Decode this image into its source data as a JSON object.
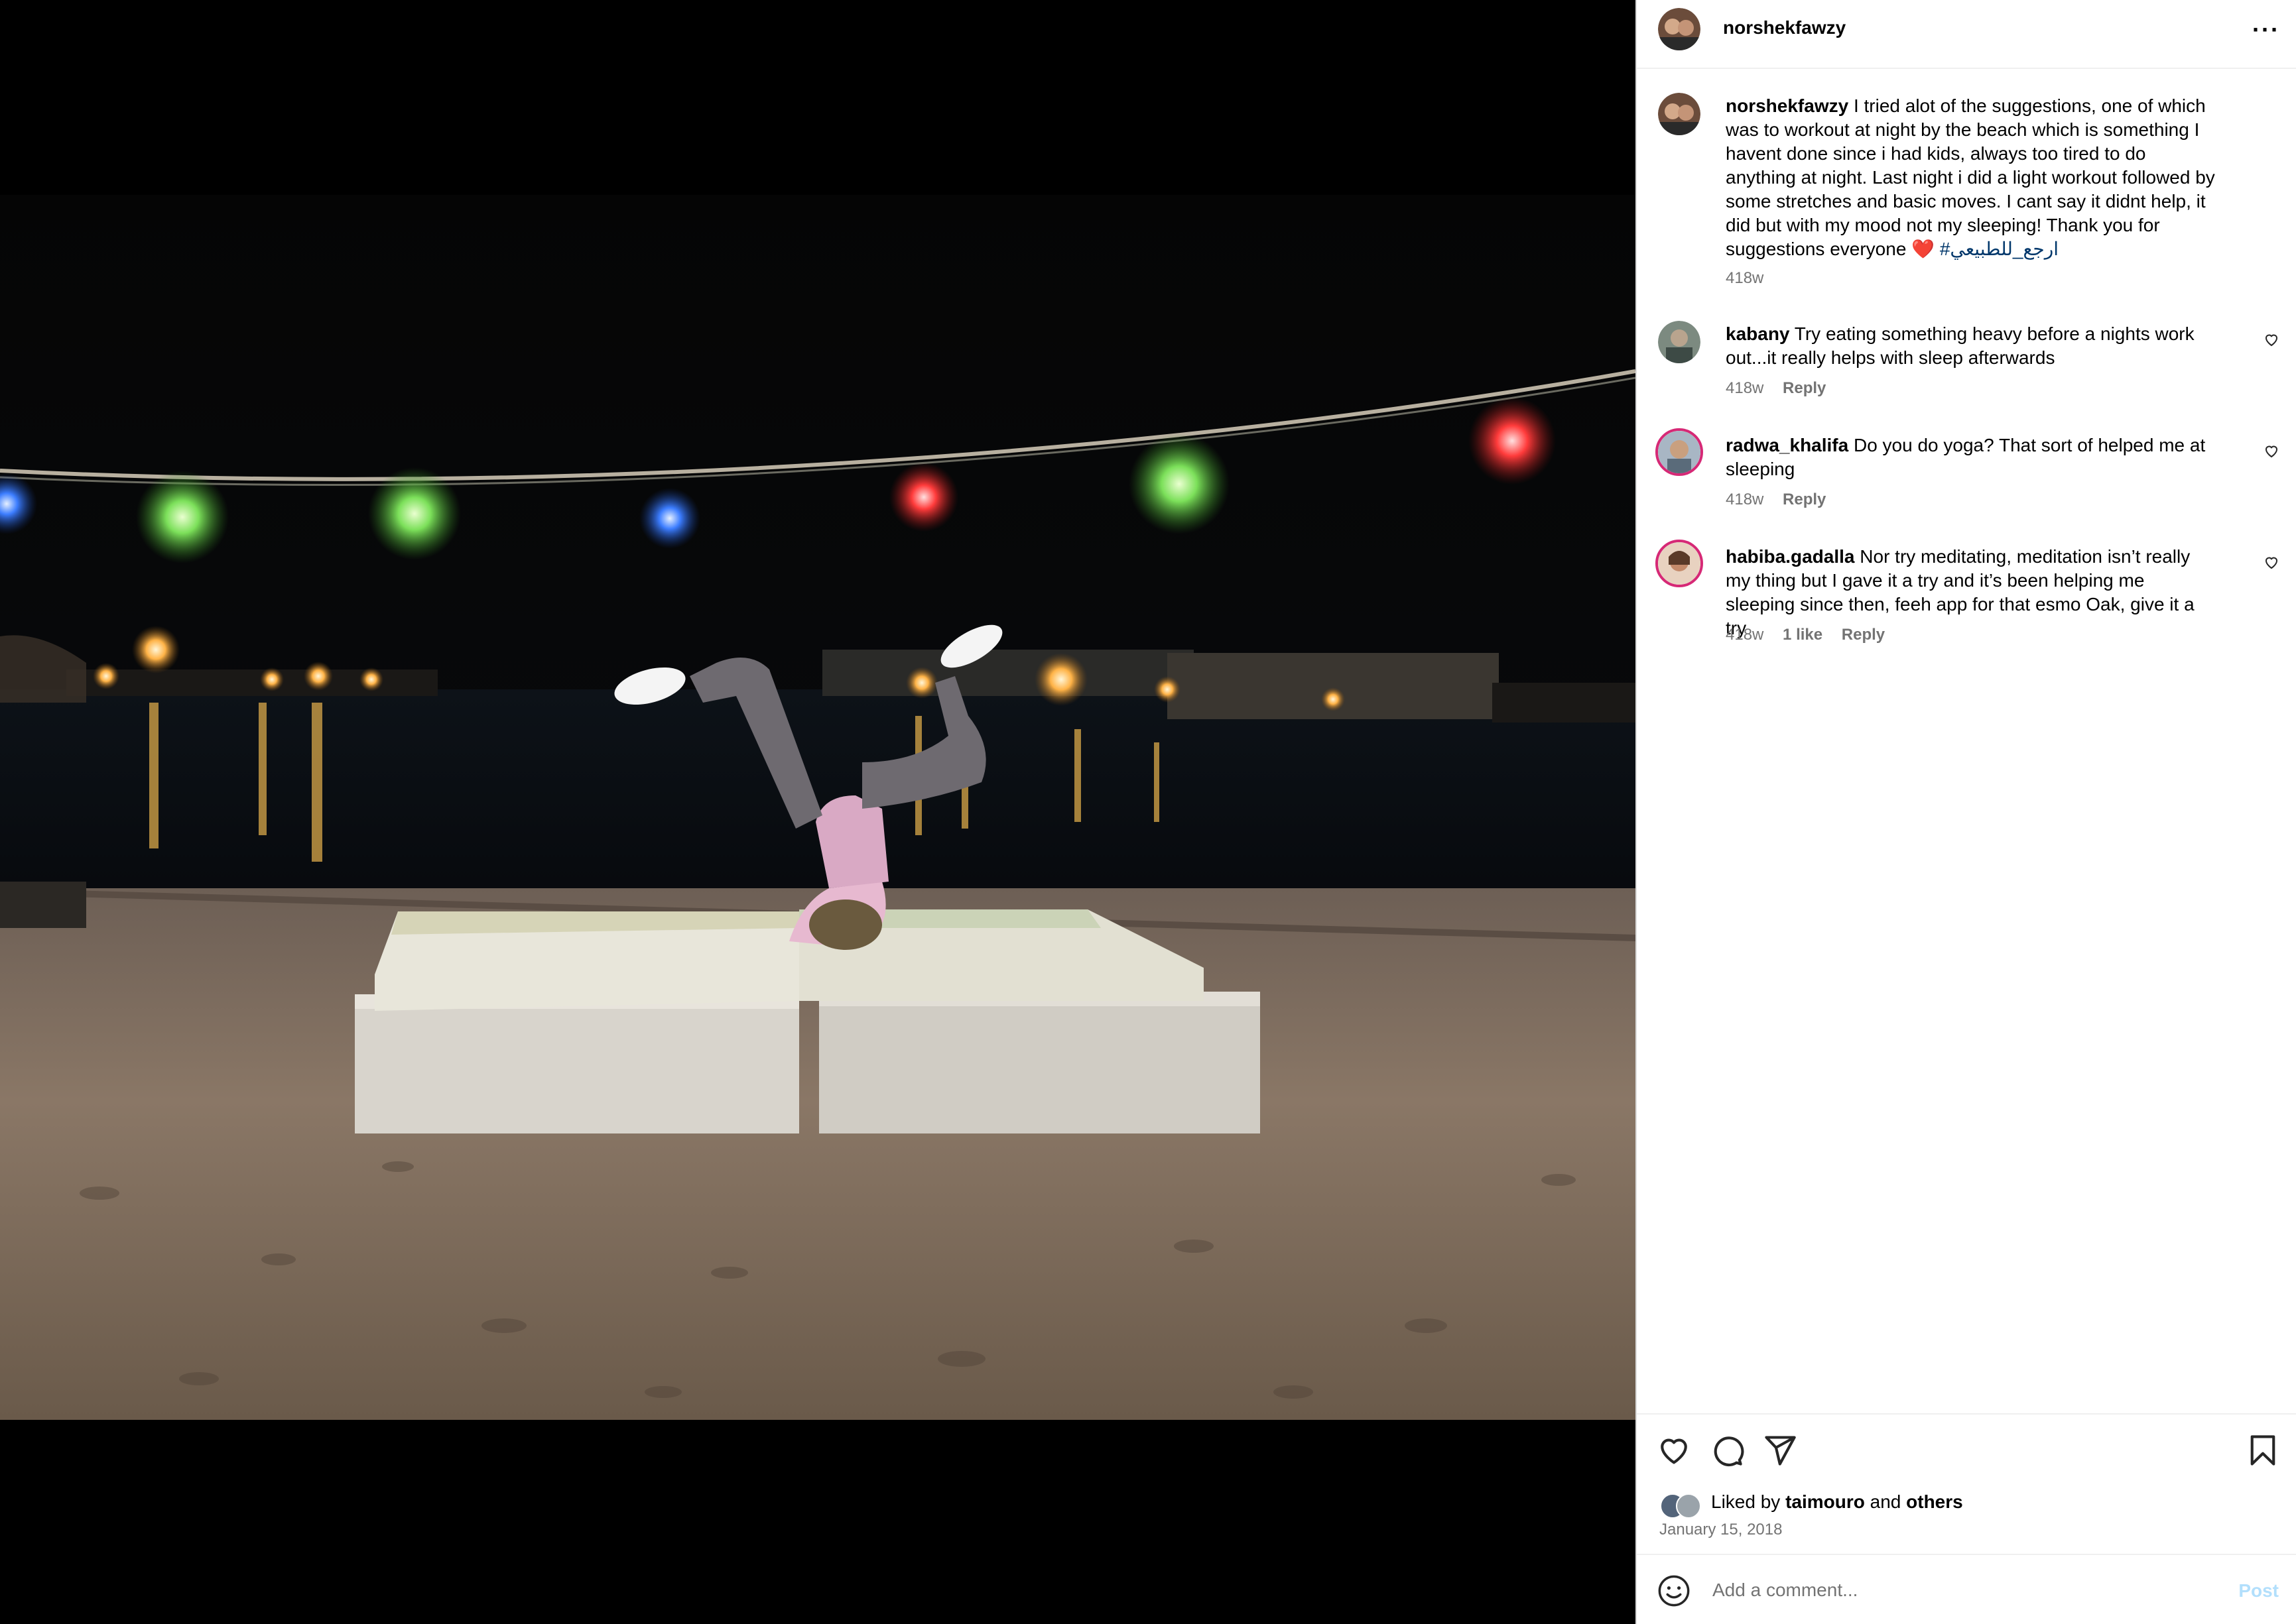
{
  "post": {
    "username": "norshekfawzy",
    "more_label": "···"
  },
  "caption": {
    "username": "norshekfawzy",
    "text": "I tried alot of the suggestions, one of which was to workout at night by the beach which is something I havent done since i had kids, always too tired to do anything at night. Last night i did a light workout followed by some stretches and basic moves. I cant say it didnt help, it did but with my mood not my sleeping! Thank you for suggestions everyone",
    "emoji": "❤️",
    "hashtag": "#ارجع_للطبيعي",
    "time": "418w"
  },
  "comments": [
    {
      "username": "kabany",
      "text": "Try eating something heavy before a nights work out...it really helps with sleep afterwards",
      "time": "418w",
      "likes": "",
      "reply": "Reply"
    },
    {
      "username": "radwa_khalifa",
      "text": "Do you do yoga? That sort of helped me at sleeping",
      "time": "418w",
      "likes": "",
      "reply": "Reply"
    },
    {
      "username": "habiba.gadalla",
      "text": "Nor try meditating, meditation isn’t really my thing but I gave it a try and it’s been helping me sleeping since then, feeh app for that esmo Oak, give it a try",
      "time": "418w",
      "likes": "1 like",
      "reply": "Reply"
    }
  ],
  "likes": {
    "prefix": "Liked by",
    "user": "taimouro",
    "and": "and",
    "others": "others"
  },
  "date": "January 15, 2018",
  "add_comment": {
    "placeholder": "Add a comment...",
    "post_label": "Post"
  },
  "colors": {
    "secondary_text": "#737373",
    "link": "#00376b",
    "post_disabled": "#b2dffc",
    "story_ring": "#d62976"
  },
  "icons": [
    "heart-icon",
    "comment-icon",
    "share-icon",
    "bookmark-icon",
    "emoji-icon",
    "more-icon"
  ]
}
